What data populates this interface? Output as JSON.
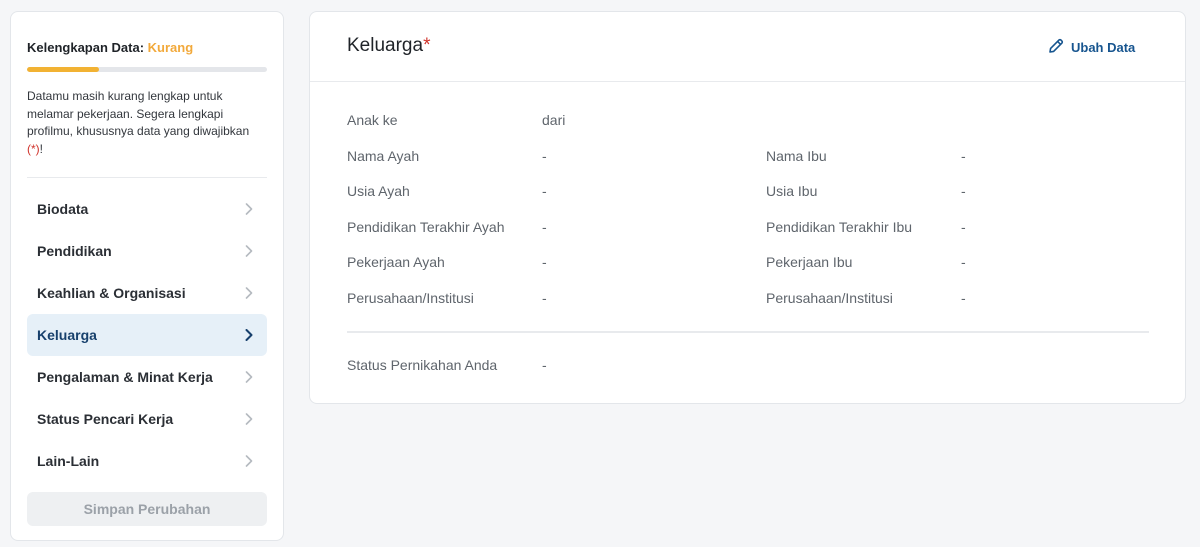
{
  "sidebar": {
    "completeness_label": "Kelengkapan Data:",
    "completeness_status": "Kurang",
    "progress_fraction": 0.3,
    "warning_text": "Datamu masih kurang lengkap untuk melamar pekerjaan. Segera lengkapi profilmu, khususnya data yang diwajibkan",
    "warning_mark": "(*)",
    "warning_end": "!",
    "items": [
      {
        "label": "Biodata",
        "active": false
      },
      {
        "label": "Pendidikan",
        "active": false
      },
      {
        "label": "Keahlian & Organisasi",
        "active": false
      },
      {
        "label": "Keluarga",
        "active": true
      },
      {
        "label": "Pengalaman & Minat Kerja",
        "active": false
      },
      {
        "label": "Status Pencari Kerja",
        "active": false
      },
      {
        "label": "Lain-Lain",
        "active": false
      }
    ],
    "save_label": "Simpan Perubahan"
  },
  "card": {
    "title": "Keluarga",
    "required_mark": "*",
    "edit_label": "Ubah Data",
    "anak_ke": {
      "label": "Anak ke",
      "value": "dari"
    },
    "ayah": [
      {
        "label": "Nama Ayah",
        "value": "-"
      },
      {
        "label": "Usia Ayah",
        "value": "-"
      },
      {
        "label": "Pendidikan Terakhir Ayah",
        "value": "-"
      },
      {
        "label": "Pekerjaan Ayah",
        "value": "-"
      },
      {
        "label": "Perusahaan/Institusi",
        "value": "-"
      }
    ],
    "ibu": [
      {
        "label": "Nama Ibu",
        "value": "-"
      },
      {
        "label": "Usia Ibu",
        "value": "-"
      },
      {
        "label": "Pendidikan Terakhir Ibu",
        "value": "-"
      },
      {
        "label": "Pekerjaan Ibu",
        "value": "-"
      },
      {
        "label": "Perusahaan/Institusi",
        "value": "-"
      }
    ],
    "marital": {
      "label": "Status Pernikahan Anda",
      "value": "-"
    }
  },
  "colors": {
    "accent": "#17558f",
    "warning": "#f2a93b",
    "required": "#d0342c",
    "active_bg": "#e6f0f8"
  },
  "icons": {
    "edit": "pencil-icon",
    "chevron": "chevron-right-icon"
  }
}
